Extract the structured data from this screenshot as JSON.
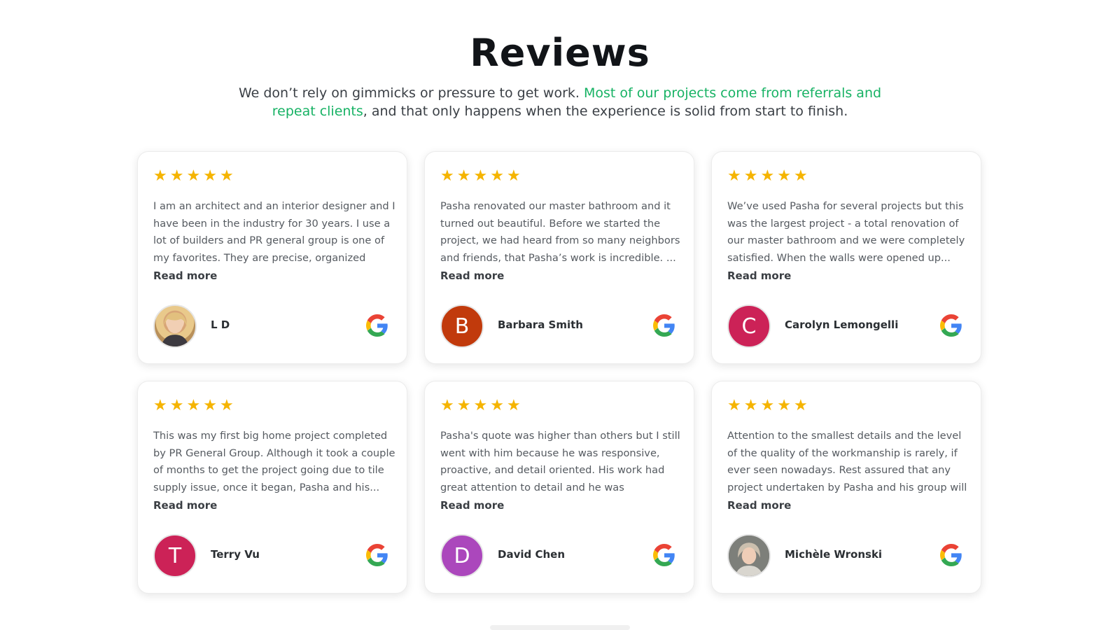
{
  "section": {
    "title": "Reviews",
    "intro_before": "We don’t rely on gimmicks or pressure to get work. ",
    "intro_highlight": "Most of our projects come from referrals and repeat clients",
    "intro_after": ", and that only happens when the experience is solid from start to finish."
  },
  "colors": {
    "accent": "#17b264",
    "star": "#f5b400",
    "avatar_b": "#c13a0c",
    "avatar_c": "#cc2257",
    "avatar_t": "#cc2257",
    "avatar_d": "#ab47bc"
  },
  "reviews": [
    {
      "stars": "★★★★★",
      "rating": 5,
      "text": "I am an architect and an interior designer and I have been in the industry for 30 years. I use a lot of builders and PR general group is one of my favorites. They are precise, organized and...",
      "read_more": "Read more",
      "name": "L D",
      "avatar_initial": "",
      "avatar_type": "photo",
      "source_icon": "google-icon"
    },
    {
      "stars": "★★★★★",
      "rating": 5,
      "text": "Pasha renovated our master bathroom and it turned out beautiful. Before we started the project, we had heard from so many neighbors and friends, that Pasha’s work is incredible. ...",
      "read_more": "Read more",
      "name": "Barbara Smith",
      "avatar_initial": "B",
      "avatar_type": "initial",
      "source_icon": "google-icon"
    },
    {
      "stars": "★★★★★",
      "rating": 5,
      "text": "We’ve used Pasha for several projects but this was the largest project - a total renovation of our master bathroom and we were completely satisfied. When the walls were opened up...",
      "read_more": "Read more",
      "name": "Carolyn Lemongelli",
      "avatar_initial": "C",
      "avatar_type": "initial",
      "source_icon": "google-icon"
    },
    {
      "stars": "★★★★★",
      "rating": 5,
      "text": "This was my first big home project completed by PR General Group. Although it took a couple of months to get the project going due to tile supply issue, once it began, Pasha and his...",
      "read_more": "Read more",
      "name": "Terry Vu",
      "avatar_initial": "T",
      "avatar_type": "initial",
      "source_icon": "google-icon"
    },
    {
      "stars": "★★★★★",
      "rating": 5,
      "text": "Pasha's quote was higher than others but I still went with him because he was responsive, proactive, and detail oriented. His work had great attention to detail and he was extremely...",
      "read_more": "Read more",
      "name": "David Chen",
      "avatar_initial": "D",
      "avatar_type": "initial",
      "source_icon": "google-icon"
    },
    {
      "stars": "★★★★★",
      "rating": 5,
      "text": "Attention to the smallest details and the level of the quality of the workmanship is rarely, if ever seen nowadays. Rest assured that any project undertaken by Pasha and his group will matc...",
      "read_more": "Read more",
      "name": "Michèle Wronski",
      "avatar_initial": "",
      "avatar_type": "photo",
      "source_icon": "google-icon"
    }
  ]
}
